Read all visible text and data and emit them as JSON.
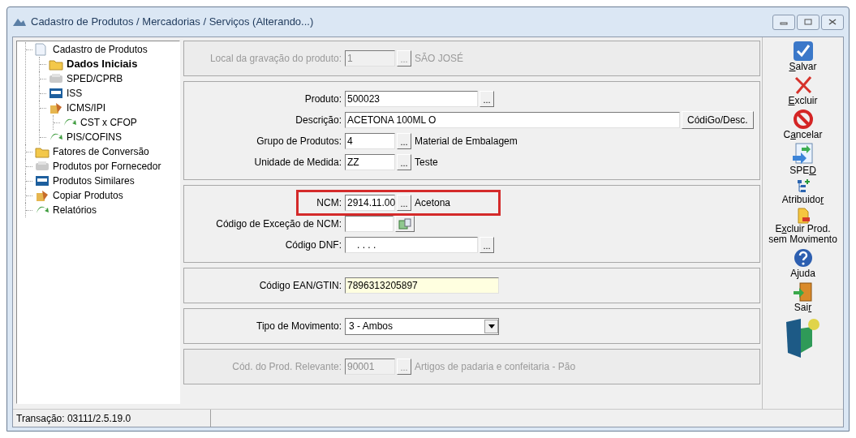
{
  "window": {
    "title": "Cadastro de Produtos / Mercadorias / Serviços (Alterando...)"
  },
  "tree": [
    {
      "label": "Cadastro de Produtos",
      "selected": false,
      "children": [
        {
          "label": "Dados Iniciais",
          "selected": true
        },
        {
          "label": "SPED/CPRB",
          "selected": false
        },
        {
          "label": "ISS",
          "selected": false
        },
        {
          "label": "ICMS/IPI",
          "selected": false,
          "children": [
            {
              "label": "CST x CFOP",
              "selected": false
            }
          ]
        },
        {
          "label": "PIS/COFINS",
          "selected": false
        }
      ]
    },
    {
      "label": "Fatores de Conversão",
      "selected": false
    },
    {
      "label": "Produtos por Fornecedor",
      "selected": false
    },
    {
      "label": "Produtos Similares",
      "selected": false
    },
    {
      "label": "Copiar Produtos",
      "selected": false
    },
    {
      "label": "Relatórios",
      "selected": false
    }
  ],
  "sections": [
    {
      "disabled": true,
      "rows": [
        {
          "kind": "lookup",
          "label": "Local da gravação do produto:",
          "value": "1",
          "button": "...",
          "description": "SÃO JOSÉ",
          "highlighted": false
        }
      ]
    },
    {
      "disabled": false,
      "rows": [
        {
          "kind": "code",
          "label": "Produto:",
          "value": "500023",
          "button": "...",
          "highlighted": false
        },
        {
          "kind": "long",
          "label": "Descrição:",
          "value": "ACETONA 100ML O",
          "button": "CódiGo/Desc.",
          "highlighted": false
        },
        {
          "kind": "lookup",
          "label": "Grupo de Produtos:",
          "value": "4",
          "button": "...",
          "description": "Material de Embalagem",
          "highlighted": false
        },
        {
          "kind": "lookup",
          "label": "Unidade de Medida:",
          "value": "ZZ",
          "button": "...",
          "description": "Teste",
          "highlighted": false
        }
      ]
    },
    {
      "disabled": false,
      "rows": [
        {
          "kind": "lookup",
          "label": "NCM:",
          "value": "2914.11.00",
          "button": "...",
          "description": "Acetona",
          "highlighted": true
        },
        {
          "kind": "exception",
          "label": "Código de Exceção de NCM:",
          "highlighted": false
        },
        {
          "kind": "masked",
          "label": "Código DNF:",
          "value": ". . . .",
          "button": "...",
          "highlighted": false
        }
      ]
    },
    {
      "disabled": false,
      "rows": [
        {
          "kind": "text",
          "label": "Código EAN/GTIN:",
          "value": "7896313205897",
          "focused": true,
          "highlighted": false
        }
      ]
    },
    {
      "disabled": false,
      "rows": [
        {
          "kind": "select",
          "label": "Tipo de Movimento:",
          "value": "3 - Ambos",
          "highlighted": false
        }
      ]
    },
    {
      "disabled": true,
      "rows": [
        {
          "kind": "lookup",
          "label": "Cód. do Prod. Relevante:",
          "value": "90001",
          "button": "...",
          "description": "Artigos de padaria e confeitaria - Pão",
          "highlighted": false
        }
      ]
    }
  ],
  "toolbar": [
    {
      "hotkey": "S",
      "text_after": "alvar"
    },
    {
      "hotkey": "E",
      "text_after": "xcluir"
    },
    {
      "text_before": "C",
      "hotkey": "a",
      "text_after": "ncelar"
    },
    {
      "text_before": "SPE",
      "hotkey": "D"
    },
    {
      "text_before": "Atribuido",
      "hotkey": "r"
    },
    {
      "text_before": "E",
      "hotkey": "x",
      "text_after": "cluir Prod. sem Movimento"
    },
    {
      "text_before": "Ajuda"
    },
    {
      "text_before": "Sai",
      "hotkey": "r"
    }
  ],
  "status_bar": {
    "text": "Transação: 03111/2.5.19.0"
  }
}
